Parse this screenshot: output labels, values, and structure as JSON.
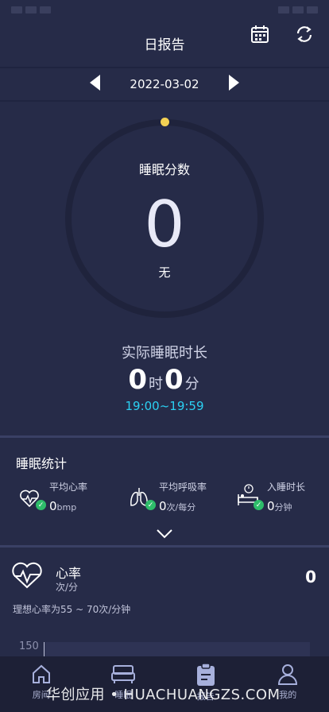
{
  "header": {
    "title": "日报告"
  },
  "date_nav": {
    "date": "2022-03-02"
  },
  "score": {
    "label": "睡眠分数",
    "value": "0",
    "level": "无"
  },
  "duration": {
    "label": "实际睡眠时长",
    "hours": "0",
    "hours_unit": "时",
    "minutes": "0",
    "minutes_unit": "分",
    "time_range": "19:00~19:59"
  },
  "stats": {
    "title": "睡眠统计",
    "items": [
      {
        "name": "平均心率",
        "value": "0",
        "unit": "bmp"
      },
      {
        "name": "平均呼吸率",
        "value": "0",
        "unit": "次/每分"
      },
      {
        "name": "入睡时长",
        "value": "0",
        "unit": "分钟"
      }
    ]
  },
  "heart_rate": {
    "title": "心率",
    "unit": "次/分",
    "value": "0",
    "ideal": "理想心率为55 ~ 70次/分钟",
    "axis_top": "150"
  },
  "bottom_nav": {
    "items": [
      {
        "label": "房间",
        "icon": "home-icon"
      },
      {
        "label": "睡眠",
        "icon": "bed-icon"
      },
      {
        "label": "报告",
        "icon": "report-icon"
      },
      {
        "label": "我的",
        "icon": "profile-icon"
      }
    ]
  },
  "watermark": "华创应用 • HUACHUANGZS.COM",
  "colors": {
    "background": "#262b48",
    "accent_cyan": "#2bd0f2",
    "dot_yellow": "#f3d154",
    "check_green": "#2ebd6a"
  }
}
